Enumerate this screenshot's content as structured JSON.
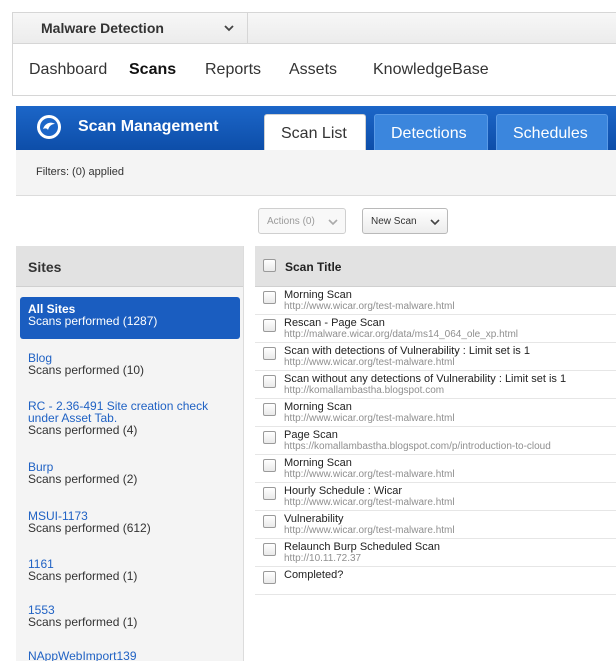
{
  "app_selector": {
    "label": "Malware Detection",
    "icon": "chevron-down-icon"
  },
  "main_nav": [
    {
      "label": "Dashboard",
      "active": false
    },
    {
      "label": "Scans",
      "active": true
    },
    {
      "label": "Reports",
      "active": false
    },
    {
      "label": "Assets",
      "active": false
    },
    {
      "label": "KnowledgeBase",
      "active": false
    }
  ],
  "module": {
    "title": "Scan Management",
    "logo_icon": "malware-shield-logo-icon"
  },
  "tabs": [
    {
      "label": "Scan List",
      "active": true
    },
    {
      "label": "Detections",
      "active": false
    },
    {
      "label": "Schedules",
      "active": false
    }
  ],
  "filters": {
    "text": "Filters: (0) applied"
  },
  "toolbar": {
    "actions_label": "Actions (0)",
    "new_scan_label": "New Scan"
  },
  "sidebar": {
    "header": "Sites",
    "items": [
      {
        "name": "All Sites",
        "count": "Scans performed (1287)",
        "active": true
      },
      {
        "name": "Blog",
        "count": "Scans performed (10)",
        "active": false
      },
      {
        "name": "RC - 2.36-491 Site creation check under Asset Tab.",
        "name_line1": "RC - 2.36-491 Site creation check",
        "name_line2": "under Asset Tab.",
        "count": "Scans performed (4)",
        "active": false
      },
      {
        "name": "Burp",
        "count": "Scans performed (2)",
        "active": false
      },
      {
        "name": "MSUI-1173",
        "count": "Scans performed (612)",
        "active": false
      },
      {
        "name": "1161",
        "count": "Scans performed (1)",
        "active": false
      },
      {
        "name": "1553",
        "count": "Scans performed (1)",
        "active": false
      },
      {
        "name": "NAppWebImport139",
        "count": "",
        "active": false
      }
    ]
  },
  "scan_list": {
    "column_header": "Scan Title",
    "rows": [
      {
        "title": "Morning Scan",
        "url": "http://www.wicar.org/test-malware.html"
      },
      {
        "title": "Rescan - Page Scan",
        "url": "http://malware.wicar.org/data/ms14_064_ole_xp.html"
      },
      {
        "title": "Scan with detections of Vulnerability : Limit set is 1",
        "url": "http://www.wicar.org/test-malware.html"
      },
      {
        "title": "Scan without any detections of Vulnerability : Limit set is 1",
        "url": "http://komallambastha.blogspot.com"
      },
      {
        "title": "Morning Scan",
        "url": "http://www.wicar.org/test-malware.html"
      },
      {
        "title": "Page Scan",
        "url": "https://komallambastha.blogspot.com/p/introduction-to-cloud"
      },
      {
        "title": "Morning Scan",
        "url": "http://www.wicar.org/test-malware.html"
      },
      {
        "title": "Hourly Schedule : Wicar",
        "url": "http://www.wicar.org/test-malware.html"
      },
      {
        "title": "Vulnerability",
        "url": "http://www.wicar.org/test-malware.html"
      },
      {
        "title": "Relaunch Burp Scheduled Scan",
        "url": "http://10.11.72.37"
      },
      {
        "title": "Completed?",
        "url": ""
      }
    ]
  },
  "colors": {
    "brand_blue": "#0d4ea9",
    "tab_blue": "#3b86dd",
    "link_blue": "#2062c4",
    "url_gray": "#8f8f8f"
  }
}
